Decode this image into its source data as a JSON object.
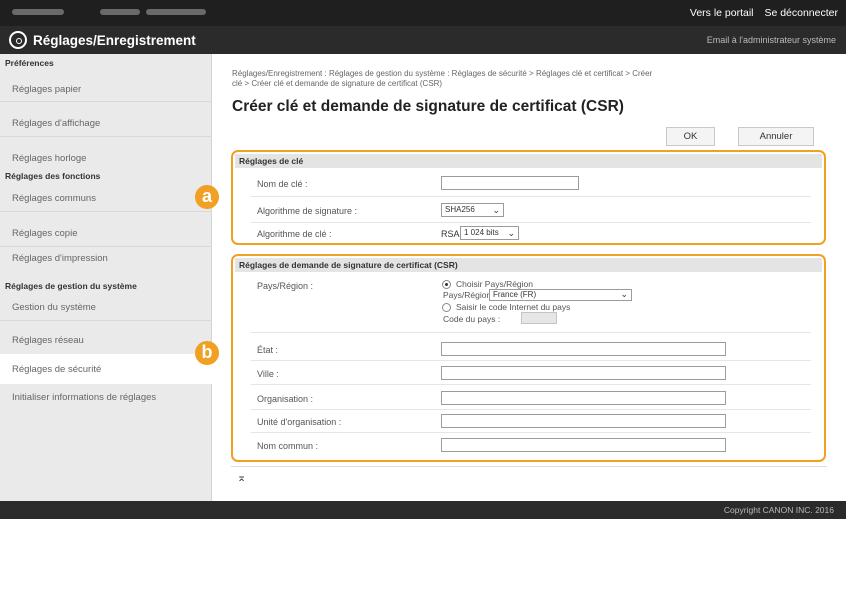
{
  "header": {
    "portal_link": "Vers le portail",
    "logout_link": "Se déconnecter",
    "app_title": "Réglages/Enregistrement",
    "admin_mail": "Email à l'administrateur système"
  },
  "sidebar": {
    "groups": [
      {
        "label": "Préférences",
        "items": [
          "Réglages papier",
          "Réglages d'affichage",
          "Réglages horloge"
        ]
      },
      {
        "label": "Réglages des fonctions",
        "items": [
          "Réglages communs",
          "Réglages copie",
          "Réglages d'impression"
        ]
      },
      {
        "label": "Réglages de gestion du système",
        "items": [
          "Gestion du système",
          "Réglages réseau",
          "Réglages de sécurité",
          "Initialiser informations de réglages"
        ]
      }
    ],
    "active_item": "Réglages de sécurité"
  },
  "badges": {
    "a": "a",
    "b": "b"
  },
  "main": {
    "breadcrumb_line1": "Réglages/Enregistrement : Réglages de gestion du système : Réglages de sécurité > Réglages clé et certificat > Créer",
    "breadcrumb_line2": "clé > Créer clé et demande de signature de certificat (CSR)",
    "title": "Créer clé et demande de signature de certificat (CSR)",
    "ok_label": "OK",
    "cancel_label": "Annuler"
  },
  "key_section": {
    "title": "Réglages de clé",
    "key_name_label": "Nom de clé :",
    "key_name_value": "",
    "sig_algo_label": "Algorithme de signature :",
    "sig_algo_value": "SHA256",
    "key_algo_label": "Algorithme de clé :",
    "key_algo_prefix": "RSA",
    "key_algo_value": "1 024 bits"
  },
  "csr_section": {
    "title": "Réglages de demande de signature de certificat (CSR)",
    "country_label": "Pays/Région :",
    "radio_choose": "Choisir Pays/Région",
    "country_select_label": "Pays/Région :",
    "country_value": "France (FR)",
    "radio_code": "Saisir le code Internet du pays",
    "country_code_label": "Code du pays :",
    "state_label": "État :",
    "city_label": "Ville :",
    "org_label": "Organisation :",
    "org_unit_label": "Unité d'organisation :",
    "common_name_label": "Nom commun :"
  },
  "footer": {
    "to_top": "⌅",
    "copyright": "Copyright CANON INC. 2016"
  },
  "colors": {
    "accent": "#f0a023",
    "header_bg": "#2b2b2b",
    "sidebar_bg": "#eaeaea"
  }
}
